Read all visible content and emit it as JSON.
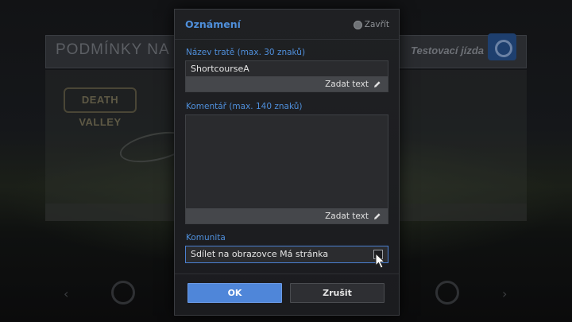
{
  "background": {
    "title": "PODMÍNKY NA TR",
    "subtitle": "Testovací jízda",
    "logo_text": "DEATH VALLEY"
  },
  "dialog": {
    "title": "Oznámení",
    "close_label": "Zavřít",
    "track_name": {
      "label": "Název tratě (max. 30 znaků)",
      "value": "ShortcourseA",
      "edit_label": "Zadat text"
    },
    "comment": {
      "label": "Komentář (max. 140 znaků)",
      "value": "",
      "edit_label": "Zadat text"
    },
    "community": {
      "label": "Komunita",
      "option_label": "Sdílet na obrazovce Má stránka",
      "checked": false
    },
    "ok_label": "OK",
    "cancel_label": "Zrušit"
  },
  "colors": {
    "accent": "#4f8fdb",
    "ok_button": "#4f86d9",
    "dialog_bg": "#1f2023"
  }
}
